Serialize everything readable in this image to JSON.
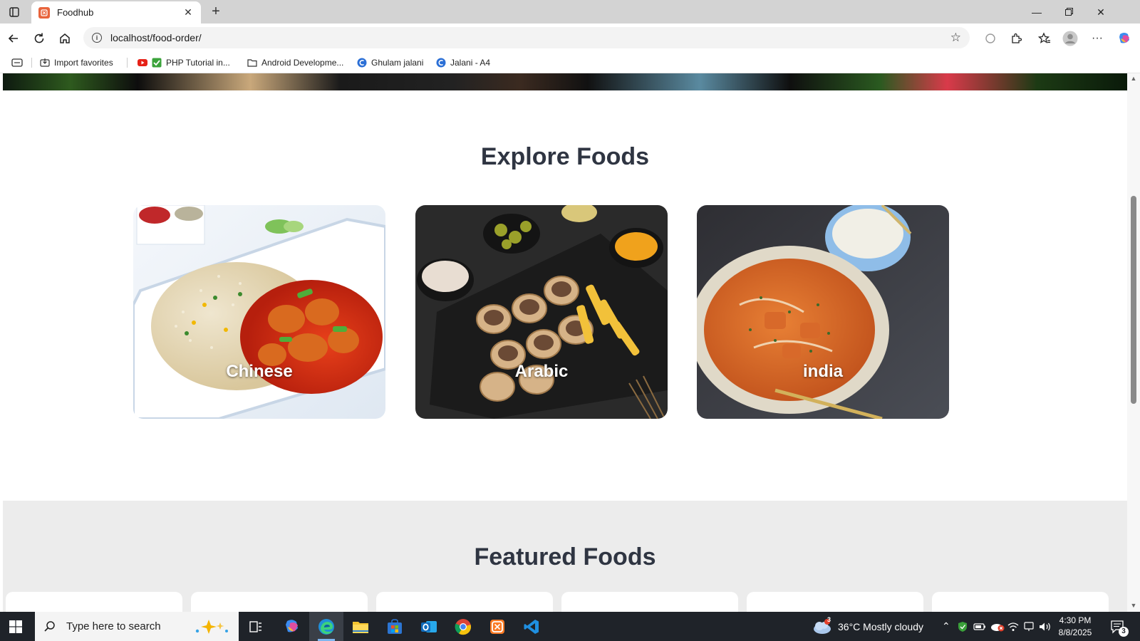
{
  "browser": {
    "tab_title": "Foodhub",
    "url": "localhost/food-order/",
    "bookmarks": [
      {
        "label": "Import favorites",
        "icon": "import-icon"
      },
      {
        "label": "PHP Tutorial in...",
        "icon": "youtube-icon"
      },
      {
        "label": "Android Developme...",
        "icon": "folder-icon"
      },
      {
        "label": "Ghulam jalani",
        "icon": "site-icon"
      },
      {
        "label": "Jalani - A4",
        "icon": "site-icon"
      }
    ]
  },
  "page": {
    "explore_title": "Explore Foods",
    "categories": [
      {
        "label": "Chinese",
        "image": "fried-rice-chicken"
      },
      {
        "label": "Arabic",
        "image": "shawarma-rolls"
      },
      {
        "label": "india",
        "image": "curry-bowl"
      }
    ],
    "featured_title": "Featured Foods"
  },
  "taskbar": {
    "search_placeholder": "Type here to search",
    "weather": "36°C  Mostly cloudy",
    "weather_badge": "3",
    "time": "4:30 PM",
    "date": "8/8/2025",
    "notifications": "3"
  },
  "colors": {
    "title_text": "#2f3542",
    "accent": "#e8643c",
    "featured_bg": "#ececec"
  }
}
